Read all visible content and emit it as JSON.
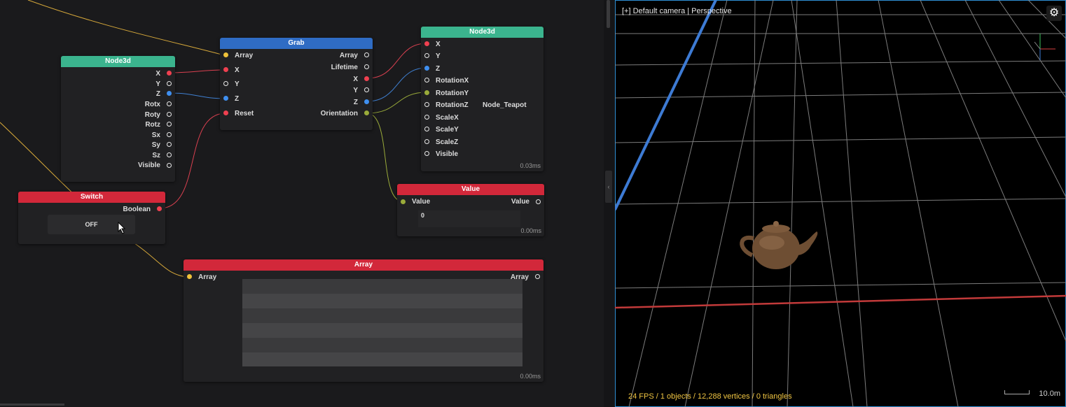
{
  "nodes": {
    "node3d_left": {
      "title": "Node3d",
      "outputs": [
        "X",
        "Y",
        "Z",
        "Rotx",
        "Roty",
        "Rotz",
        "Sx",
        "Sy",
        "Sz",
        "Visible"
      ]
    },
    "grab": {
      "title": "Grab",
      "inputs": [
        "Array",
        "X",
        "Y",
        "Z",
        "Reset"
      ],
      "outputs": [
        "Array",
        "Lifetime",
        "X",
        "Y",
        "Z",
        "Orientation"
      ]
    },
    "node3d_right": {
      "title": "Node3d",
      "inputs": [
        "X",
        "Y",
        "Z",
        "RotationX",
        "RotationY",
        "RotationZ",
        "ScaleX",
        "ScaleY",
        "ScaleZ",
        "Visible"
      ],
      "node_name": "Node_Teapot",
      "timing": "0.03ms"
    },
    "switch": {
      "title": "Switch",
      "output": "Boolean",
      "button_label": "OFF"
    },
    "value": {
      "title": "Value",
      "input": "Value",
      "output": "Value",
      "field_value": "0",
      "timing": "0.00ms"
    },
    "array": {
      "title": "Array",
      "input": "Array",
      "output": "Array",
      "timing": "0.00ms"
    }
  },
  "viewport": {
    "camera_label": "[+] Default camera | Perspective",
    "stats": "24 FPS / 1 objects / 12,288 vertices / 0 triangles",
    "scale": "10.0m",
    "settings_icon": "gear-icon"
  },
  "colors": {
    "header_green": "#3bb48e",
    "header_blue": "#2f6cc4",
    "header_red": "#d2283a",
    "accent_blue": "#2f8fd4",
    "stats_yellow": "#f0c542"
  }
}
